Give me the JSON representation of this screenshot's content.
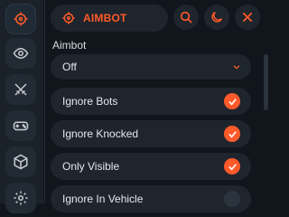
{
  "header": {
    "title": "AIMBOT",
    "icons": [
      "crosshair-icon",
      "search-icon",
      "moon-icon",
      "close-icon"
    ]
  },
  "sidebar": {
    "items": [
      {
        "icon": "crosshair-icon",
        "active": true
      },
      {
        "icon": "eye-icon",
        "active": false
      },
      {
        "icon": "swords-icon",
        "active": false
      },
      {
        "icon": "gamepad-icon",
        "active": false
      },
      {
        "icon": "package-icon",
        "active": false
      },
      {
        "icon": "gear-icon",
        "active": false
      }
    ]
  },
  "main": {
    "section_label": "Aimbot",
    "select_value": "Off",
    "options": [
      {
        "label": "Ignore Bots",
        "checked": true
      },
      {
        "label": "Ignore Knocked",
        "checked": true
      },
      {
        "label": "Only Visible",
        "checked": true
      },
      {
        "label": "Ignore In Vehicle",
        "checked": false
      }
    ]
  },
  "colors": {
    "accent": "#ff5a2a",
    "background": "#11161c",
    "panel": "#1e252d",
    "sidebar": "#1a2128"
  }
}
